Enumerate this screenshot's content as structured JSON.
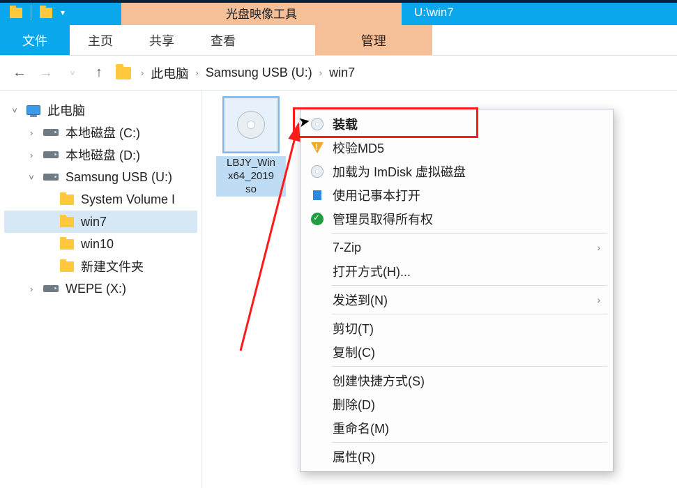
{
  "titlebar": {
    "context_tool": "光盘映像工具",
    "window_title": "U:\\win7"
  },
  "ribbon": {
    "file": "文件",
    "tabs": [
      "主页",
      "共享",
      "查看"
    ],
    "context_tab": "管理"
  },
  "nav": {
    "back": "←",
    "forward": "→",
    "up": "↑",
    "dropdown": "˅",
    "crumbs": [
      "此电脑",
      "Samsung USB (U:)",
      "win7"
    ]
  },
  "tree": {
    "root": "此电脑",
    "items": [
      {
        "label": "本地磁盘 (C:)",
        "kind": "drive",
        "exp": ">"
      },
      {
        "label": "本地磁盘 (D:)",
        "kind": "drive",
        "exp": ">"
      },
      {
        "label": "Samsung USB (U:)",
        "kind": "drive",
        "exp": "˅",
        "children": [
          {
            "label": "System Volume I",
            "kind": "folder"
          },
          {
            "label": "win7",
            "kind": "folder",
            "sel": true
          },
          {
            "label": "win10",
            "kind": "folder"
          },
          {
            "label": "新建文件夹",
            "kind": "folder"
          }
        ]
      },
      {
        "label": "WEPE (X:)",
        "kind": "drive",
        "exp": ">"
      }
    ]
  },
  "file_item": {
    "name_line1": "LBJY_Win",
    "name_line2": "x64_2019",
    "name_line3": "so"
  },
  "context_menu": {
    "items": [
      {
        "icon": "disc",
        "label": "装载",
        "bold": true
      },
      {
        "icon": "shield-y",
        "label": "校验MD5"
      },
      {
        "icon": "disc",
        "label": "加载为 ImDisk 虚拟磁盘"
      },
      {
        "icon": "note",
        "label": "使用记事本打开"
      },
      {
        "icon": "shield-g",
        "label": "管理员取得所有权"
      },
      {
        "sep": true
      },
      {
        "label": "7-Zip",
        "sub": true
      },
      {
        "label": "打开方式(H)..."
      },
      {
        "sep": true
      },
      {
        "label": "发送到(N)",
        "sub": true
      },
      {
        "sep": true
      },
      {
        "label": "剪切(T)"
      },
      {
        "label": "复制(C)"
      },
      {
        "sep": true
      },
      {
        "label": "创建快捷方式(S)"
      },
      {
        "label": "删除(D)"
      },
      {
        "label": "重命名(M)"
      },
      {
        "sep": true
      },
      {
        "label": "属性(R)"
      }
    ]
  }
}
